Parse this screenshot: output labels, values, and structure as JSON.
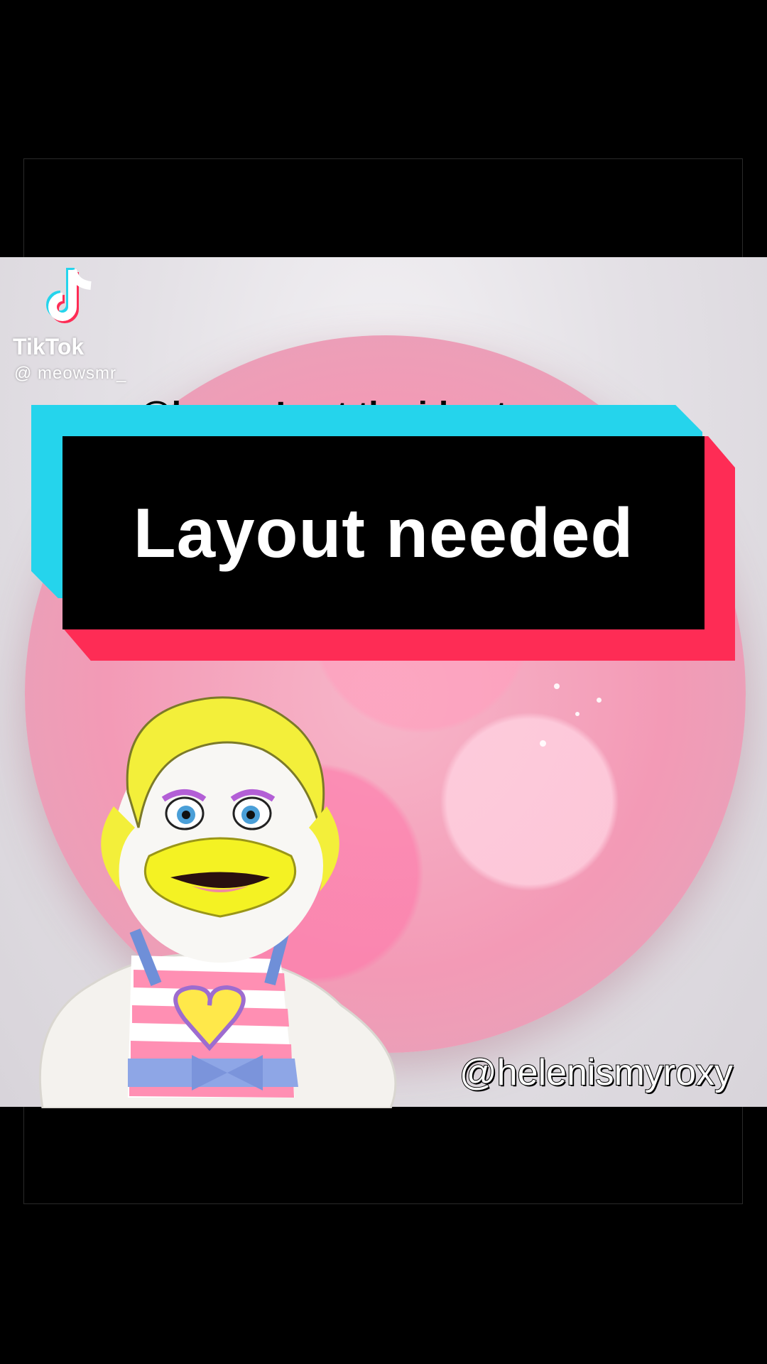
{
  "video": {
    "source_logo_text": "TikTok",
    "source_handle": "@ meowsmr_",
    "cut_caption": "@kayce.I got the idea to"
  },
  "banner": {
    "text": "Layout needed",
    "colors": {
      "cyan": "#25d4ec",
      "red": "#fe2c55",
      "black": "#000000"
    }
  },
  "overlay": {
    "puppet": "puppet-character-icon",
    "watermark_handle": "@helenismyroxy"
  }
}
